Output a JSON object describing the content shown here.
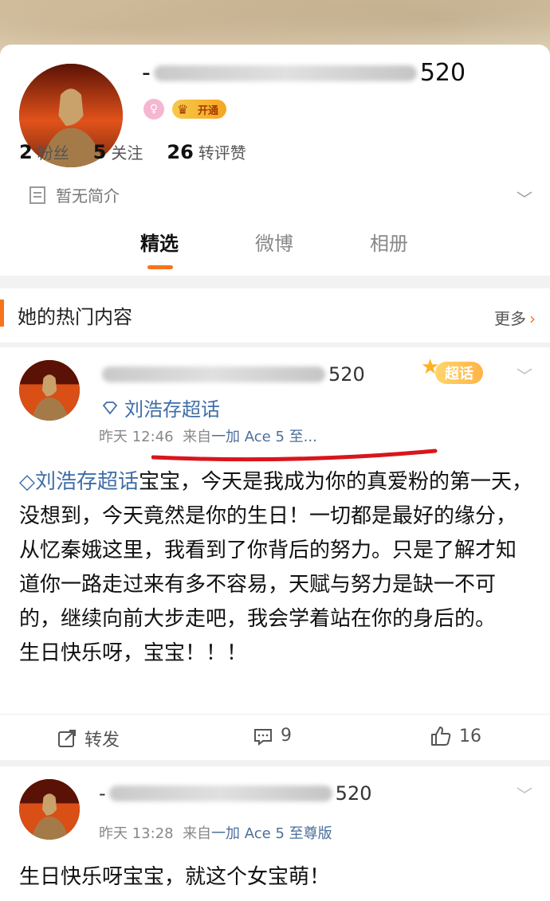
{
  "profile": {
    "name_prefix": "-",
    "name_suffix": "520",
    "vip_label": "开通",
    "stats": [
      {
        "value": "2",
        "label": "粉丝"
      },
      {
        "value": "5",
        "label": "关注"
      },
      {
        "value": "26",
        "label": "转评赞"
      }
    ],
    "bio": "暂无简介",
    "tabs": [
      "精选",
      "微博",
      "相册"
    ]
  },
  "section": {
    "title": "她的热门内容",
    "more_label": "更多"
  },
  "posts": [
    {
      "name_suffix": "520",
      "super_badge": "超话",
      "topic": "刘浩存超话",
      "time": "昨天 12:46",
      "source_prefix": "来自",
      "source": "一加 Ace 5 至...",
      "text_topic": "刘浩存超话",
      "text": "宝宝，今天是我成为你的真爱粉的第一天，没想到，今天竟然是你的生日！一切都是最好的缘分，从忆秦娥这里，我看到了你背后的努力。只是了解才知道你一路走过来有多不容易，天赋与努力是缺一不可的，继续向前大步走吧，我会学着站在你的身后的。",
      "text_line2": "生日快乐呀，宝宝！！！",
      "actions": {
        "repost": "转发",
        "comments": "9",
        "likes": "16"
      }
    },
    {
      "name_prefix": "-",
      "name_suffix": "520",
      "time": "昨天 13:28",
      "source_prefix": "来自",
      "source": "一加 Ace 5 至尊版",
      "text": "生日快乐呀宝宝，就这个女宝萌！"
    }
  ]
}
